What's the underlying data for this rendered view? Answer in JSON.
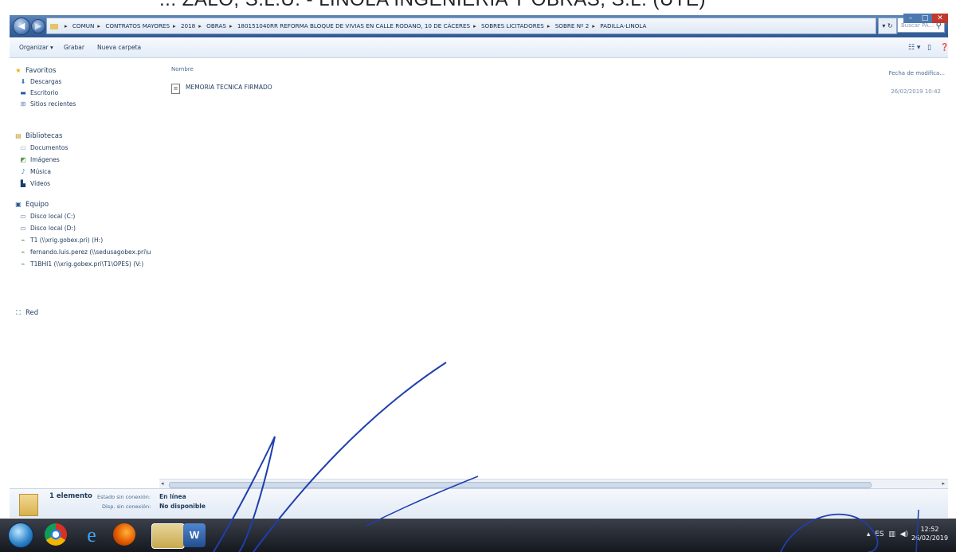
{
  "header_text": "... ZALO, S.L.U. - LINOLA INGENIERIA Y OBRAS, S.L. (UTE)",
  "breadcrumb": [
    "COMUN",
    "CONTRATOS MAYORES",
    "2018",
    "OBRAS",
    "180151040RR REFORMA BLOQUE DE VIVIAS EN CALLE RODANO, 10 DE CÁCERES",
    "SOBRES LICITADORES",
    "SOBRE Nº 2",
    "PADILLA-LINOLA"
  ],
  "search": {
    "placeholder": "Buscar PA..."
  },
  "toolbar": {
    "organize": "Organizar ▾",
    "share": "Grabar",
    "new_folder": "Nueva carpeta"
  },
  "sidebar": {
    "favorites": {
      "title": "Favoritos",
      "items": [
        "Descargas",
        "Escritorio",
        "Sitios recientes"
      ]
    },
    "libraries": {
      "title": "Bibliotecas",
      "items": [
        "Documentos",
        "Imágenes",
        "Música",
        "Vídeos"
      ]
    },
    "computer": {
      "title": "Equipo",
      "items": [
        "Disco local (C:)",
        "Disco local (D:)",
        "T1 (\\\\xrig.gobex.pri) (H:)",
        "fernando.luis.perez (\\\\sedusagobex.pri\\u",
        "T1BHI1 (\\\\xrig.gobex.pri\\T1\\OPES) (V:)"
      ]
    },
    "network": {
      "title": "Red"
    }
  },
  "columns": {
    "name": "Nombre",
    "date": "Fecha de modifica..."
  },
  "files": [
    {
      "name": "MEMORIA TECNICA FIRMADO",
      "date": "26/02/2019 10:42"
    }
  ],
  "details": {
    "count": "1 elemento",
    "state_label": "Estado sin conexión:",
    "state_value": "En línea",
    "availability_label": "Disp. sin conexión:",
    "availability_value": "No disponible"
  },
  "taskbar": {
    "clock_time": "12:52",
    "clock_date": "26/02/2019",
    "apps": [
      "start-orb",
      "chrome",
      "internet-explorer",
      "firefox",
      "file-explorer",
      "word"
    ]
  },
  "tray": {
    "language": "ES"
  }
}
